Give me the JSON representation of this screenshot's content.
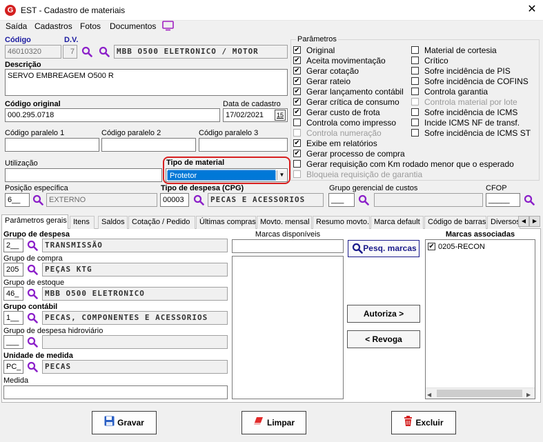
{
  "window": {
    "title": "EST - Cadastro de materiais",
    "logo": "G",
    "close": "✕"
  },
  "menu": {
    "items": [
      "Saída",
      "Cadastros",
      "Fotos",
      "Documentos"
    ]
  },
  "header": {
    "codigo_label": "Código",
    "codigo_value": "46010320",
    "dv_label": "D.V.",
    "dv_value": "7",
    "nome_value": "MBB O500 ELETRONICO  / MOTOR",
    "descricao_label": "Descrição",
    "descricao_value": "SERVO EMBREAGEM O500 R",
    "codigo_original_label": "Código original",
    "codigo_original_value": "000.295.0718",
    "data_cadastro_label": "Data de cadastro",
    "data_cadastro_value": "17/02/2021",
    "calendar_value": "15",
    "paralelo1_label": "Código paralelo 1",
    "paralelo2_label": "Código paralelo 2",
    "paralelo3_label": "Código paralelo 3",
    "utilizacao_label": "Utilização",
    "tipo_material_label": "Tipo de material",
    "tipo_material_value": "Protetor",
    "posicao_label": "Posição específica",
    "posicao_code": "6__",
    "posicao_value": "EXTERNO",
    "tipo_despesa_label": "Tipo de despesa (CPG)",
    "tipo_despesa_code": "00003",
    "tipo_despesa_value": "PECAS E ACESSORIOS",
    "grupo_gerencial_label": "Grupo gerencial de custos",
    "grupo_gerencial_code": "___",
    "cfop_label": "CFOP",
    "cfop_value": "_____"
  },
  "parametros": {
    "title": "Parâmetros",
    "left": [
      {
        "label": "Original",
        "checked": true,
        "disabled": false
      },
      {
        "label": "Aceita movimentação",
        "checked": true,
        "disabled": false
      },
      {
        "label": "Gerar cotação",
        "checked": true,
        "disabled": false
      },
      {
        "label": "Gerar rateio",
        "checked": true,
        "disabled": false
      },
      {
        "label": "Gerar lançamento contábil",
        "checked": true,
        "disabled": false
      },
      {
        "label": "Gerar crítica de consumo",
        "checked": true,
        "disabled": false
      },
      {
        "label": "Gerar custo de frota",
        "checked": true,
        "disabled": false
      },
      {
        "label": "Controla como impresso",
        "checked": false,
        "disabled": false
      },
      {
        "label": "Controla numeração",
        "checked": false,
        "disabled": true
      },
      {
        "label": "Exibe em relatórios",
        "checked": true,
        "disabled": false
      },
      {
        "label": "Gerar processo de compra",
        "checked": true,
        "disabled": false
      },
      {
        "label": "Gerar requisição com Km rodado menor que o esperado",
        "checked": false,
        "disabled": false
      },
      {
        "label": "Bloqueia requisição de garantia",
        "checked": false,
        "disabled": true
      }
    ],
    "right": [
      {
        "label": "Material de cortesia",
        "checked": false,
        "disabled": false
      },
      {
        "label": "Crítico",
        "checked": false,
        "disabled": false
      },
      {
        "label": "Sofre incidência de PIS",
        "checked": false,
        "disabled": false
      },
      {
        "label": "Sofre incidência de COFINS",
        "checked": false,
        "disabled": false
      },
      {
        "label": "Controla garantia",
        "checked": false,
        "disabled": false
      },
      {
        "label": "Controla material por lote",
        "checked": false,
        "disabled": true
      },
      {
        "label": "Sofre incidência de ICMS",
        "checked": false,
        "disabled": false
      },
      {
        "label": "Incide ICMS NF de transf.",
        "checked": false,
        "disabled": false
      },
      {
        "label": "Sofre incidência de ICMS ST",
        "checked": false,
        "disabled": false
      }
    ]
  },
  "tabs": [
    "Parâmetros gerais",
    "Itens",
    "Saldos",
    "Cotação / Pedido",
    "Últimas compras",
    "Movto. mensal",
    "Resumo movto.",
    "Marca default",
    "Código de barras",
    "Diversos"
  ],
  "tab_scroll": [
    "◀",
    "▶"
  ],
  "geral": {
    "grupo_despesa_label": "Grupo de despesa",
    "grupo_despesa_code": "2__",
    "grupo_despesa_value": "TRANSMISSÃO",
    "grupo_compra_label": "Grupo de compra",
    "grupo_compra_code": "205",
    "grupo_compra_value": "PEÇAS KTG",
    "grupo_estoque_label": "Grupo de estoque",
    "grupo_estoque_code": "46_",
    "grupo_estoque_value": "MBB O500 ELETRONICO",
    "grupo_contabil_label": "Grupo contábil",
    "grupo_contabil_code": "1__",
    "grupo_contabil_value": "PECAS, COMPONENTES E ACESSORIOS",
    "grupo_hidro_label": "Grupo de despesa hidroviário",
    "grupo_hidro_code": "___",
    "unidade_label": "Unidade de medida",
    "unidade_code": "PC_",
    "unidade_value": "PECAS",
    "medida_label": "Medida"
  },
  "marcas": {
    "disponiveis_label": "Marcas disponíveis",
    "pesq_button": "Pesq. marcas",
    "autoriza_button": "Autoriza >",
    "revoga_button": "< Revoga",
    "associadas_label": "Marcas associadas",
    "associadas": [
      {
        "label": "0205-RECON",
        "checked": true
      }
    ]
  },
  "footer": {
    "gravar": "Gravar",
    "limpar": "Limpar",
    "excluir": "Excluir"
  },
  "colors": {
    "accent": "#2a2ad8",
    "highlight_circle": "#d81f1f",
    "selection": "#0078d7"
  }
}
